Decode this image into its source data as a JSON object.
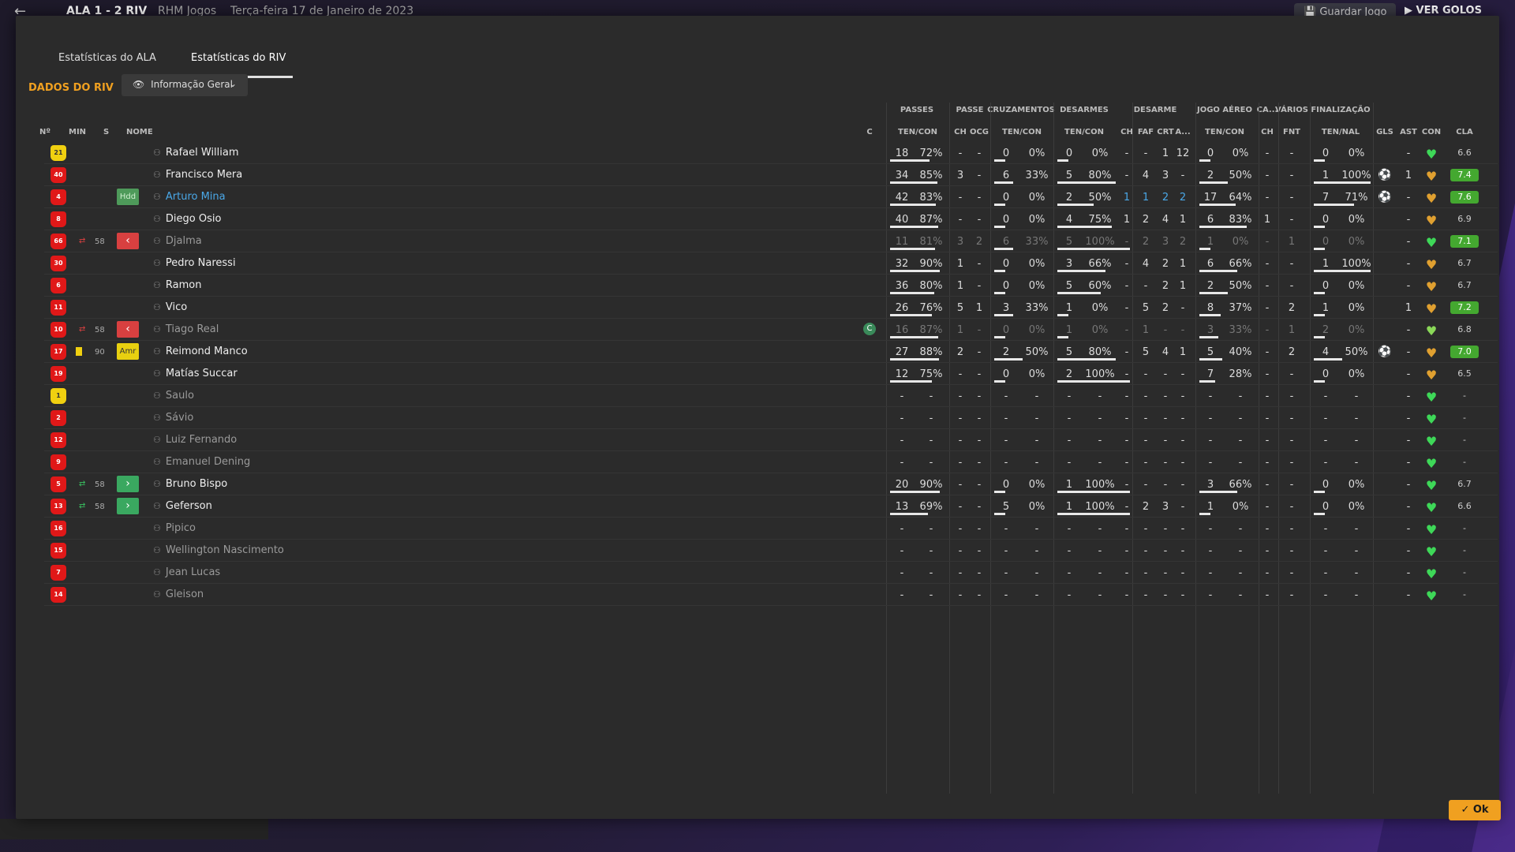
{
  "topbar": {
    "back_icon": "←",
    "score": "ALA  1 - 2  RIV",
    "competition": "RHM Jogos",
    "date": "Terça-feira 17 de Janeiro de 2023",
    "save_label": "Guardar Jogo",
    "play_label": "VER GOLOS"
  },
  "tabs": [
    {
      "label": "Estatísticas do ALA"
    },
    {
      "label": "Estatísticas do RIV"
    }
  ],
  "section": {
    "title": "DADOS DO RIV",
    "dropdown": "Informação Geral"
  },
  "groups": [
    "PASSES",
    "PASSE",
    "CRUZAMENTOS",
    "DESARMES",
    "DESARME",
    "JOGO AÉREO",
    "CA...",
    "VÁRIOS",
    "FINALIZAÇÃO"
  ],
  "headers": {
    "num": "Nº",
    "min": "MIN",
    "s": "S",
    "nome": "NOME",
    "c": "C",
    "passes": "TEN/CON",
    "passe_ch": "CH",
    "passe_ocg": "OCG",
    "cruz": "TEN/CON",
    "desarmes": "TEN/CON",
    "des_ch": "CH",
    "des_faf": "FAF",
    "des_crt": "CRT",
    "des_a": "A...",
    "aereo": "TEN/CON",
    "ca_ch": "CH",
    "fnt": "FNT",
    "fin": "TEN/NAL",
    "gls": "GLS",
    "ast": "AST",
    "con": "CON",
    "cla": "CLA"
  },
  "colors": {
    "accent": "#f0a020",
    "good": "#44a830"
  },
  "players": [
    {
      "num": "21",
      "gk": true,
      "min": "",
      "ev": "",
      "badge": "",
      "badge_type": "",
      "name": "Rafael William",
      "name_style": "",
      "cap": "",
      "p": [
        "18",
        "72%"
      ],
      "pw": 72,
      "pch": "-",
      "pocg": "-",
      "cr": [
        "0",
        "0%"
      ],
      "crw": 0,
      "de": [
        "0",
        "0%"
      ],
      "dew": 0,
      "dch": "-",
      "dfaf": "-",
      "dcrt": "1",
      "da": "12",
      "ae": [
        "0",
        "0%"
      ],
      "aew": 0,
      "cach": "-",
      "fnt": "-",
      "fi": [
        "0",
        "0%"
      ],
      "fiw": 0,
      "gls": "",
      "ast": "-",
      "con": "green",
      "cla": "6.6",
      "clag": false
    },
    {
      "num": "40",
      "gk": false,
      "min": "",
      "ev": "",
      "badge": "",
      "badge_type": "",
      "name": "Francisco Mera",
      "name_style": "",
      "cap": "",
      "p": [
        "34",
        "85%"
      ],
      "pw": 85,
      "pch": "3",
      "pocg": "-",
      "cr": [
        "6",
        "33%"
      ],
      "crw": 33,
      "de": [
        "5",
        "80%"
      ],
      "dew": 80,
      "dch": "-",
      "dfaf": "4",
      "dcrt": "3",
      "da": "-",
      "ae": [
        "2",
        "50%"
      ],
      "aew": 50,
      "cach": "-",
      "fnt": "-",
      "fi": [
        "1",
        "100%"
      ],
      "fiw": 100,
      "gls": "ball",
      "ast": "1",
      "con": "gold",
      "cla": "7.4",
      "clag": true
    },
    {
      "num": "4",
      "gk": false,
      "min": "",
      "ev": "",
      "badge": "Hdd",
      "badge_type": "hdd",
      "name": "Arturo Mina",
      "name_style": "blue",
      "cap": "",
      "p": [
        "42",
        "83%"
      ],
      "pw": 83,
      "pch": "-",
      "pocg": "-",
      "cr": [
        "0",
        "0%"
      ],
      "crw": 0,
      "de": [
        "2",
        "50%"
      ],
      "dew": 50,
      "dch": "1",
      "dfaf": "1",
      "dcrt": "2",
      "da": "2",
      "dblue": true,
      "ae": [
        "17",
        "64%"
      ],
      "aew": 64,
      "cach": "-",
      "fnt": "-",
      "fi": [
        "7",
        "71%"
      ],
      "fiw": 71,
      "gls": "ball",
      "ast": "-",
      "con": "gold",
      "cla": "7.6",
      "clag": true
    },
    {
      "num": "8",
      "gk": false,
      "min": "",
      "ev": "",
      "badge": "",
      "badge_type": "",
      "name": "Diego Osio",
      "name_style": "",
      "cap": "",
      "p": [
        "40",
        "87%"
      ],
      "pw": 87,
      "pch": "-",
      "pocg": "-",
      "cr": [
        "0",
        "0%"
      ],
      "crw": 0,
      "de": [
        "4",
        "75%"
      ],
      "dew": 75,
      "dch": "1",
      "dfaf": "2",
      "dcrt": "4",
      "da": "1",
      "ae": [
        "6",
        "83%"
      ],
      "aew": 83,
      "cach": "1",
      "fnt": "-",
      "fi": [
        "0",
        "0%"
      ],
      "fiw": 0,
      "gls": "",
      "ast": "-",
      "con": "gold",
      "cla": "6.9",
      "clag": false
    },
    {
      "num": "66",
      "gk": false,
      "min": "58",
      "ev": "out",
      "badge": "‹",
      "badge_type": "sub-out",
      "name": "Djalma",
      "name_style": "dim",
      "cap": "",
      "p": [
        "11",
        "81%"
      ],
      "pw": 81,
      "pch": "3",
      "pocg": "2",
      "cr": [
        "6",
        "33%"
      ],
      "crw": 33,
      "de": [
        "5",
        "100%"
      ],
      "dew": 100,
      "dch": "-",
      "dfaf": "2",
      "dcrt": "3",
      "da": "2",
      "ae": [
        "1",
        "0%"
      ],
      "aew": 0,
      "cach": "-",
      "fnt": "1",
      "fi": [
        "0",
        "0%"
      ],
      "fiw": 0,
      "gls": "",
      "ast": "-",
      "con": "green",
      "cla": "7.1",
      "clag": true,
      "dimstats": true
    },
    {
      "num": "30",
      "gk": false,
      "min": "",
      "ev": "",
      "badge": "",
      "badge_type": "",
      "name": "Pedro Naressi",
      "name_style": "",
      "cap": "",
      "p": [
        "32",
        "90%"
      ],
      "pw": 90,
      "pch": "1",
      "pocg": "-",
      "cr": [
        "0",
        "0%"
      ],
      "crw": 0,
      "de": [
        "3",
        "66%"
      ],
      "dew": 66,
      "dch": "-",
      "dfaf": "4",
      "dcrt": "2",
      "da": "1",
      "ae": [
        "6",
        "66%"
      ],
      "aew": 66,
      "cach": "-",
      "fnt": "-",
      "fi": [
        "1",
        "100%"
      ],
      "fiw": 100,
      "gls": "",
      "ast": "-",
      "con": "gold",
      "cla": "6.7",
      "clag": false
    },
    {
      "num": "6",
      "gk": false,
      "min": "",
      "ev": "",
      "badge": "",
      "badge_type": "",
      "name": "Ramon",
      "name_style": "",
      "cap": "",
      "p": [
        "36",
        "80%"
      ],
      "pw": 80,
      "pch": "1",
      "pocg": "-",
      "cr": [
        "0",
        "0%"
      ],
      "crw": 0,
      "de": [
        "5",
        "60%"
      ],
      "dew": 60,
      "dch": "-",
      "dfaf": "-",
      "dcrt": "2",
      "da": "1",
      "ae": [
        "2",
        "50%"
      ],
      "aew": 50,
      "cach": "-",
      "fnt": "-",
      "fi": [
        "0",
        "0%"
      ],
      "fiw": 0,
      "gls": "",
      "ast": "-",
      "con": "gold",
      "cla": "6.7",
      "clag": false
    },
    {
      "num": "11",
      "gk": false,
      "min": "",
      "ev": "",
      "badge": "",
      "badge_type": "",
      "name": "Vico",
      "name_style": "",
      "cap": "",
      "p": [
        "26",
        "76%"
      ],
      "pw": 76,
      "pch": "5",
      "pocg": "1",
      "cr": [
        "3",
        "33%"
      ],
      "crw": 33,
      "de": [
        "1",
        "0%"
      ],
      "dew": 0,
      "dch": "-",
      "dfaf": "5",
      "dcrt": "2",
      "da": "-",
      "ae": [
        "8",
        "37%"
      ],
      "aew": 37,
      "cach": "-",
      "fnt": "2",
      "fi": [
        "1",
        "0%"
      ],
      "fiw": 0,
      "gls": "",
      "ast": "1",
      "con": "gold",
      "cla": "7.2",
      "clag": true
    },
    {
      "num": "10",
      "gk": false,
      "min": "58",
      "ev": "out",
      "badge": "‹",
      "badge_type": "sub-out",
      "name": "Tiago Real",
      "name_style": "dim",
      "cap": "C",
      "p": [
        "16",
        "87%"
      ],
      "pw": 87,
      "pch": "1",
      "pocg": "-",
      "cr": [
        "0",
        "0%"
      ],
      "crw": 0,
      "de": [
        "1",
        "0%"
      ],
      "dew": 0,
      "dch": "-",
      "dfaf": "1",
      "dcrt": "-",
      "da": "-",
      "ae": [
        "3",
        "33%"
      ],
      "aew": 33,
      "cach": "-",
      "fnt": "1",
      "fi": [
        "2",
        "0%"
      ],
      "fiw": 0,
      "gls": "",
      "ast": "-",
      "con": "lg",
      "cla": "6.8",
      "clag": false,
      "dimstats": true
    },
    {
      "num": "17",
      "gk": false,
      "min": "90",
      "ev": "yc",
      "badge": "Amr",
      "badge_type": "amr",
      "name": "Reimond Manco",
      "name_style": "",
      "cap": "",
      "p": [
        "27",
        "88%"
      ],
      "pw": 88,
      "pch": "2",
      "pocg": "-",
      "cr": [
        "2",
        "50%"
      ],
      "crw": 50,
      "de": [
        "5",
        "80%"
      ],
      "dew": 80,
      "dch": "-",
      "dfaf": "5",
      "dcrt": "4",
      "da": "1",
      "ae": [
        "5",
        "40%"
      ],
      "aew": 40,
      "cach": "-",
      "fnt": "2",
      "fi": [
        "4",
        "50%"
      ],
      "fiw": 50,
      "gls": "ball",
      "ast": "-",
      "con": "gold",
      "cla": "7.0",
      "clag": true
    },
    {
      "num": "19",
      "gk": false,
      "min": "",
      "ev": "",
      "badge": "",
      "badge_type": "",
      "name": "Matías Succar",
      "name_style": "",
      "cap": "",
      "p": [
        "12",
        "75%"
      ],
      "pw": 75,
      "pch": "-",
      "pocg": "-",
      "cr": [
        "0",
        "0%"
      ],
      "crw": 0,
      "de": [
        "2",
        "100%"
      ],
      "dew": 100,
      "dch": "-",
      "dfaf": "-",
      "dcrt": "-",
      "da": "-",
      "ae": [
        "7",
        "28%"
      ],
      "aew": 28,
      "cach": "-",
      "fnt": "-",
      "fi": [
        "0",
        "0%"
      ],
      "fiw": 0,
      "gls": "",
      "ast": "-",
      "con": "gold",
      "cla": "6.5",
      "clag": false
    },
    {
      "num": "1",
      "gk": true,
      "min": "",
      "ev": "",
      "badge": "",
      "badge_type": "",
      "name": "Saulo",
      "name_style": "dim",
      "cap": "",
      "p": [
        "-",
        "-"
      ],
      "pw": -1,
      "pch": "-",
      "pocg": "-",
      "cr": [
        "-",
        "-"
      ],
      "crw": -1,
      "de": [
        "-",
        "-"
      ],
      "dew": -1,
      "dch": "-",
      "dfaf": "-",
      "dcrt": "-",
      "da": "-",
      "ae": [
        "-",
        "-"
      ],
      "aew": -1,
      "cach": "-",
      "fnt": "-",
      "fi": [
        "-",
        "-"
      ],
      "fiw": -1,
      "gls": "",
      "ast": "-",
      "con": "green",
      "cla": "-",
      "clag": false
    },
    {
      "num": "2",
      "gk": false,
      "min": "",
      "ev": "",
      "badge": "",
      "badge_type": "",
      "name": "Sávio",
      "name_style": "dim",
      "cap": "",
      "p": [
        "-",
        "-"
      ],
      "pw": -1,
      "pch": "-",
      "pocg": "-",
      "cr": [
        "-",
        "-"
      ],
      "crw": -1,
      "de": [
        "-",
        "-"
      ],
      "dew": -1,
      "dch": "-",
      "dfaf": "-",
      "dcrt": "-",
      "da": "-",
      "ae": [
        "-",
        "-"
      ],
      "aew": -1,
      "cach": "-",
      "fnt": "-",
      "fi": [
        "-",
        "-"
      ],
      "fiw": -1,
      "gls": "",
      "ast": "-",
      "con": "green",
      "cla": "-",
      "clag": false
    },
    {
      "num": "12",
      "gk": false,
      "min": "",
      "ev": "",
      "badge": "",
      "badge_type": "",
      "name": "Luiz Fernando",
      "name_style": "dim",
      "cap": "",
      "p": [
        "-",
        "-"
      ],
      "pw": -1,
      "pch": "-",
      "pocg": "-",
      "cr": [
        "-",
        "-"
      ],
      "crw": -1,
      "de": [
        "-",
        "-"
      ],
      "dew": -1,
      "dch": "-",
      "dfaf": "-",
      "dcrt": "-",
      "da": "-",
      "ae": [
        "-",
        "-"
      ],
      "aew": -1,
      "cach": "-",
      "fnt": "-",
      "fi": [
        "-",
        "-"
      ],
      "fiw": -1,
      "gls": "",
      "ast": "-",
      "con": "green",
      "cla": "-",
      "clag": false
    },
    {
      "num": "9",
      "gk": false,
      "min": "",
      "ev": "",
      "badge": "",
      "badge_type": "",
      "name": "Emanuel Dening",
      "name_style": "dim",
      "cap": "",
      "p": [
        "-",
        "-"
      ],
      "pw": -1,
      "pch": "-",
      "pocg": "-",
      "cr": [
        "-",
        "-"
      ],
      "crw": -1,
      "de": [
        "-",
        "-"
      ],
      "dew": -1,
      "dch": "-",
      "dfaf": "-",
      "dcrt": "-",
      "da": "-",
      "ae": [
        "-",
        "-"
      ],
      "aew": -1,
      "cach": "-",
      "fnt": "-",
      "fi": [
        "-",
        "-"
      ],
      "fiw": -1,
      "gls": "",
      "ast": "-",
      "con": "green",
      "cla": "-",
      "clag": false
    },
    {
      "num": "5",
      "gk": false,
      "min": "58",
      "ev": "in",
      "badge": "›",
      "badge_type": "sub-in",
      "name": "Bruno Bispo",
      "name_style": "",
      "cap": "",
      "p": [
        "20",
        "90%"
      ],
      "pw": 90,
      "pch": "-",
      "pocg": "-",
      "cr": [
        "0",
        "0%"
      ],
      "crw": 0,
      "de": [
        "1",
        "100%"
      ],
      "dew": 100,
      "dch": "-",
      "dfaf": "-",
      "dcrt": "-",
      "da": "-",
      "ae": [
        "3",
        "66%"
      ],
      "aew": 66,
      "cach": "-",
      "fnt": "-",
      "fi": [
        "0",
        "0%"
      ],
      "fiw": 0,
      "gls": "",
      "ast": "-",
      "con": "green",
      "cla": "6.7",
      "clag": false
    },
    {
      "num": "13",
      "gk": false,
      "min": "58",
      "ev": "in",
      "badge": "›",
      "badge_type": "sub-in",
      "name": "Geferson",
      "name_style": "",
      "cap": "",
      "p": [
        "13",
        "69%"
      ],
      "pw": 69,
      "pch": "-",
      "pocg": "-",
      "cr": [
        "5",
        "0%"
      ],
      "crw": 0,
      "de": [
        "1",
        "100%"
      ],
      "dew": 100,
      "dch": "-",
      "dfaf": "2",
      "dcrt": "3",
      "da": "-",
      "ae": [
        "1",
        "0%"
      ],
      "aew": 0,
      "cach": "-",
      "fnt": "-",
      "fi": [
        "0",
        "0%"
      ],
      "fiw": 0,
      "gls": "",
      "ast": "-",
      "con": "green",
      "cla": "6.6",
      "clag": false
    },
    {
      "num": "16",
      "gk": false,
      "min": "",
      "ev": "",
      "badge": "",
      "badge_type": "",
      "name": "Pipico",
      "name_style": "dim",
      "cap": "",
      "p": [
        "-",
        "-"
      ],
      "pw": -1,
      "pch": "-",
      "pocg": "-",
      "cr": [
        "-",
        "-"
      ],
      "crw": -1,
      "de": [
        "-",
        "-"
      ],
      "dew": -1,
      "dch": "-",
      "dfaf": "-",
      "dcrt": "-",
      "da": "-",
      "ae": [
        "-",
        "-"
      ],
      "aew": -1,
      "cach": "-",
      "fnt": "-",
      "fi": [
        "-",
        "-"
      ],
      "fiw": -1,
      "gls": "",
      "ast": "-",
      "con": "green",
      "cla": "-",
      "clag": false
    },
    {
      "num": "15",
      "gk": false,
      "min": "",
      "ev": "",
      "badge": "",
      "badge_type": "",
      "name": "Wellington Nascimento",
      "name_style": "dim",
      "cap": "",
      "p": [
        "-",
        "-"
      ],
      "pw": -1,
      "pch": "-",
      "pocg": "-",
      "cr": [
        "-",
        "-"
      ],
      "crw": -1,
      "de": [
        "-",
        "-"
      ],
      "dew": -1,
      "dch": "-",
      "dfaf": "-",
      "dcrt": "-",
      "da": "-",
      "ae": [
        "-",
        "-"
      ],
      "aew": -1,
      "cach": "-",
      "fnt": "-",
      "fi": [
        "-",
        "-"
      ],
      "fiw": -1,
      "gls": "",
      "ast": "-",
      "con": "green",
      "cla": "-",
      "clag": false
    },
    {
      "num": "7",
      "gk": false,
      "min": "",
      "ev": "",
      "badge": "",
      "badge_type": "",
      "name": "Jean Lucas",
      "name_style": "dim",
      "cap": "",
      "p": [
        "-",
        "-"
      ],
      "pw": -1,
      "pch": "-",
      "pocg": "-",
      "cr": [
        "-",
        "-"
      ],
      "crw": -1,
      "de": [
        "-",
        "-"
      ],
      "dew": -1,
      "dch": "-",
      "dfaf": "-",
      "dcrt": "-",
      "da": "-",
      "ae": [
        "-",
        "-"
      ],
      "aew": -1,
      "cach": "-",
      "fnt": "-",
      "fi": [
        "-",
        "-"
      ],
      "fiw": -1,
      "gls": "",
      "ast": "-",
      "con": "green",
      "cla": "-",
      "clag": false
    },
    {
      "num": "14",
      "gk": false,
      "min": "",
      "ev": "",
      "badge": "",
      "badge_type": "",
      "name": "Gleison",
      "name_style": "dim",
      "cap": "",
      "p": [
        "-",
        "-"
      ],
      "pw": -1,
      "pch": "-",
      "pocg": "-",
      "cr": [
        "-",
        "-"
      ],
      "crw": -1,
      "de": [
        "-",
        "-"
      ],
      "dew": -1,
      "dch": "-",
      "dfaf": "-",
      "dcrt": "-",
      "da": "-",
      "ae": [
        "-",
        "-"
      ],
      "aew": -1,
      "cach": "-",
      "fnt": "-",
      "fi": [
        "-",
        "-"
      ],
      "fiw": -1,
      "gls": "",
      "ast": "-",
      "con": "green",
      "cla": "-",
      "clag": false
    }
  ],
  "ok_label": "✓ Ok"
}
